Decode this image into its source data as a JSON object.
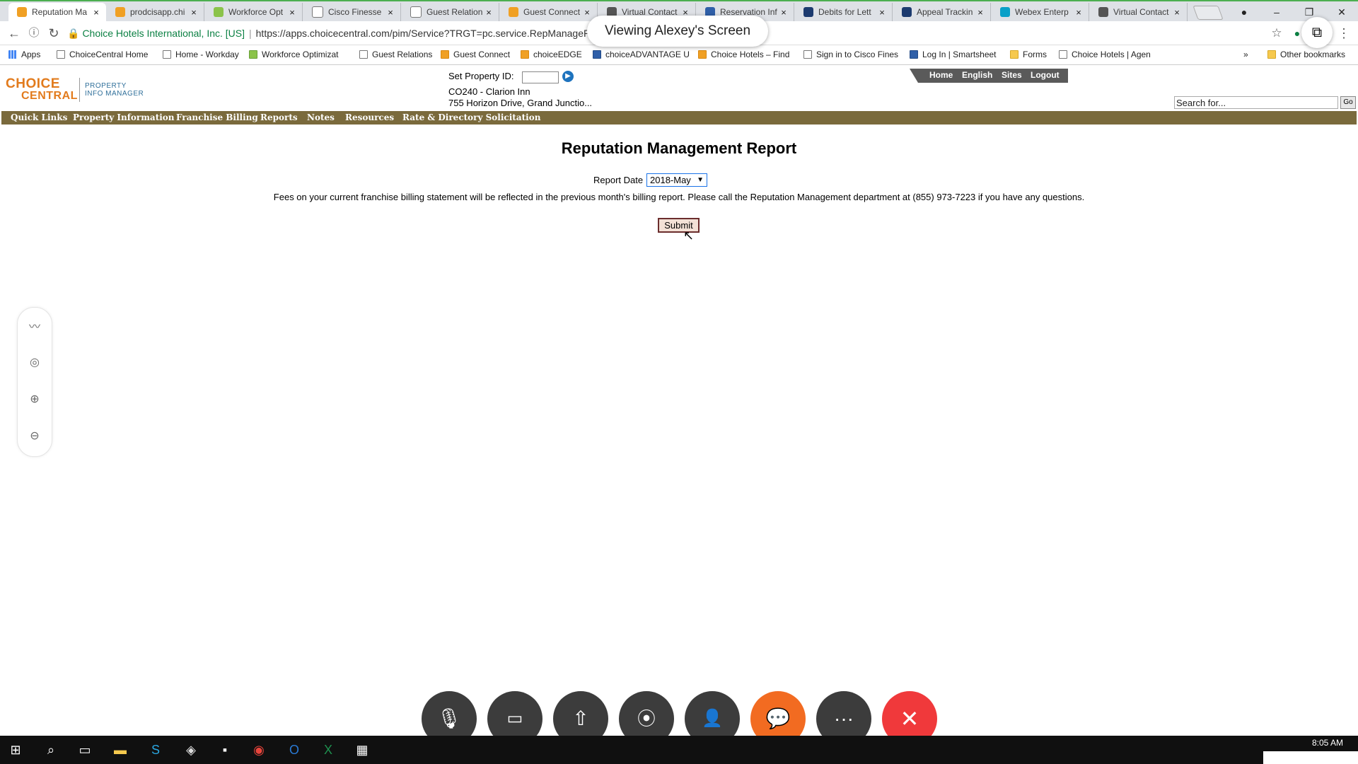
{
  "browser": {
    "tabs": [
      {
        "title": "Reputation Ma",
        "icon": "choice-icon",
        "active": true
      },
      {
        "title": "prodcisapp.chi",
        "icon": "choice-icon"
      },
      {
        "title": "Workforce Opt",
        "icon": "workforce-icon"
      },
      {
        "title": "Cisco Finesse",
        "icon": "page-icon"
      },
      {
        "title": "Guest Relation",
        "icon": "page-icon"
      },
      {
        "title": "Guest Connect",
        "icon": "choice-icon"
      },
      {
        "title": "Virtual Contact",
        "icon": "webex-icon"
      },
      {
        "title": "Reservation Inf",
        "icon": "choiceadvantage-icon"
      },
      {
        "title": "Debits for Lett",
        "icon": "smartsheet-icon"
      },
      {
        "title": "Appeal Trackin",
        "icon": "smartsheet-icon"
      },
      {
        "title": "Webex Enterp",
        "icon": "webex-globe-icon"
      },
      {
        "title": "Virtual Contact",
        "icon": "webex-icon"
      }
    ],
    "tab_close": "×",
    "address": {
      "org": "Choice Hotels International, Inc. [US]",
      "url": "https://apps.choicecentral.com/pim/Service?TRGT=pc.service.RepManageRp"
    },
    "bookmarks": [
      {
        "label": "Apps",
        "icon": "apps-grid-icon"
      },
      {
        "label": "ChoiceCentral Home",
        "icon": "page-icon"
      },
      {
        "label": "Home - Workday",
        "icon": "workday-icon"
      },
      {
        "label": "Workforce Optimizat",
        "icon": "workforce-icon"
      },
      {
        "label": "Guest Relations",
        "icon": "page-icon"
      },
      {
        "label": "Guest Connect",
        "icon": "choice-icon"
      },
      {
        "label": "choiceEDGE",
        "icon": "choice-icon"
      },
      {
        "label": "choiceADVANTAGE U",
        "icon": "choiceadvantage-icon"
      },
      {
        "label": "Choice Hotels – Find",
        "icon": "choice-icon"
      },
      {
        "label": "Sign in to Cisco Fines",
        "icon": "page-icon"
      },
      {
        "label": "Log In | Smartsheet",
        "icon": "smartsheet-icon"
      },
      {
        "label": "Forms",
        "icon": "folder-icon"
      },
      {
        "label": "Choice Hotels | Agen",
        "icon": "page-icon"
      }
    ],
    "bookmarks_overflow": "»",
    "other_bookmarks": "Other bookmarks"
  },
  "webex": {
    "viewing_label": "Viewing Alexey's Screen",
    "controls": [
      "mute-icon",
      "video-icon",
      "share-icon",
      "record-icon",
      "participants-icon",
      "chat-icon",
      "more-icon",
      "end-call-icon"
    ],
    "colors": {
      "dark": "#3c3c3c",
      "chat": "#f26b21",
      "end": "#f0393b"
    }
  },
  "site": {
    "logo": {
      "line1": "CHOICE",
      "line2": "CENTRAL",
      "sub1": "PROPERTY",
      "sub2": "INFO MANAGER"
    },
    "set_property_label": "Set Property ID:",
    "property_name": "CO240 - Clarion Inn",
    "property_address": "755 Horizon Drive, Grand Junctio...",
    "top_links": [
      "Home",
      "English",
      "Sites",
      "Logout"
    ],
    "search_placeholder": "Search for...",
    "search_go": "Go",
    "menu": [
      "Quick Links",
      "Property Information",
      "Franchise Billing",
      "Reports",
      "Notes",
      "Resources",
      "Rate & Directory Solicitation"
    ],
    "colors": {
      "menu_bar": "#7a6a3c",
      "brand_orange": "#e27b1d"
    }
  },
  "report": {
    "title": "Reputation Management Report",
    "date_label": "Report Date",
    "date_value": "2018-May",
    "notice": "Fees on your current franchise billing statement will be reflected in the previous month's billing report. Please call the Reputation Management department at (855) 973-7223 if you have any questions.",
    "submit_label": "Submit"
  },
  "annotation_tools": [
    "draw-icon",
    "pointer-icon",
    "zoom-in-icon",
    "zoom-out-icon"
  ],
  "taskbar": {
    "items": [
      "windows-start-icon",
      "search-icon",
      "task-view-icon",
      "file-explorer-icon",
      "skype-icon",
      "app-icon",
      "sticky-notes-icon",
      "chrome-icon",
      "outlook-icon",
      "excel-icon",
      "calculator-icon"
    ],
    "clock": "8:05 AM"
  }
}
